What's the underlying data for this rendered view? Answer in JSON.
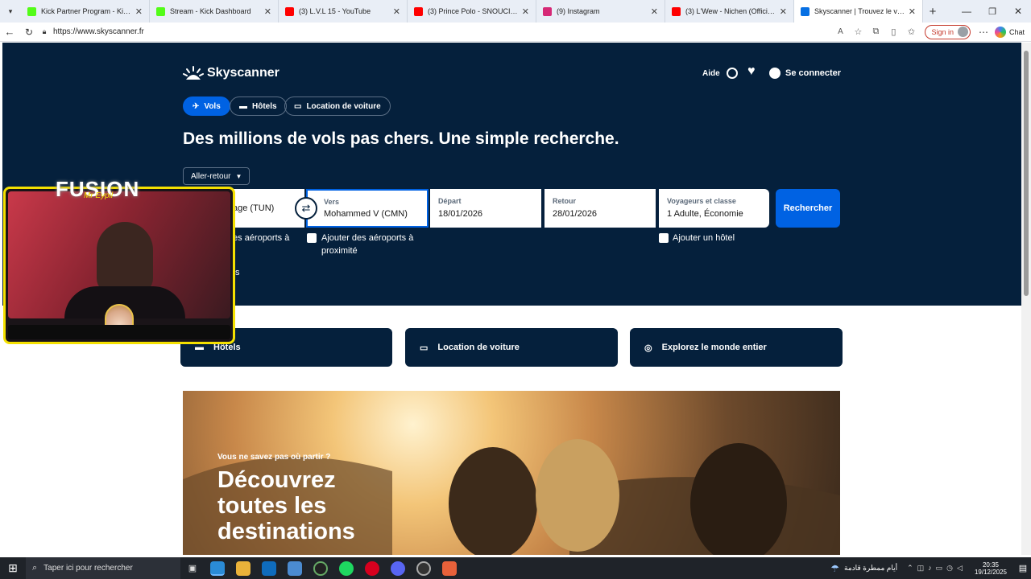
{
  "browser": {
    "tabs": [
      {
        "title": "Kick Partner Program - Kick Dashb",
        "favicon_color": "#53fc18"
      },
      {
        "title": "Stream - Kick Dashboard",
        "favicon_color": "#53fc18"
      },
      {
        "title": "(3) L.V.L 15 - YouTube",
        "favicon_color": "#ff0000"
      },
      {
        "title": "(3) Prince Polo - SNOUCI (Official",
        "favicon_color": "#ff0000"
      },
      {
        "title": "(9) Instagram",
        "favicon_color": "#d62976"
      },
      {
        "title": "(3) L'Wew - Nichen (Official Lyric V",
        "favicon_color": "#ff0000"
      },
      {
        "title": "Skyscanner | Trouvez le vol pas ch",
        "favicon_color": "#0770e3"
      }
    ],
    "new_tab": "+",
    "url": "https://www.skyscanner.fr",
    "sign_in": "Sign in",
    "chat": "Chat"
  },
  "site": {
    "logo": "Skyscanner",
    "header": {
      "help": "Aide",
      "login": "Se connecter"
    },
    "nav_pills": [
      {
        "label": "Vols",
        "active": true
      },
      {
        "label": "Hôtels",
        "active": false
      },
      {
        "label": "Location de voiture",
        "active": false
      }
    ],
    "headline": "Des millions de vols pas chers. Une simple recherche.",
    "trip_type": "Aller-retour",
    "search": {
      "from_partial": "age (TUN)",
      "to": {
        "label": "Vers",
        "value": "Mohammed V (CMN)"
      },
      "depart": {
        "label": "Départ",
        "value": "18/01/2026"
      },
      "return": {
        "label": "Retour",
        "value": "28/01/2026"
      },
      "travelers": {
        "label": "Voyageurs et classe",
        "value": "1 Adulte, Économie"
      },
      "button": "Rechercher"
    },
    "options": {
      "nearby_from_partial": "es aéroports à",
      "nearby_to": "Ajouter des aéroports à proximité",
      "hotel": "Ajouter un hôtel",
      "direct_partial": "ts"
    },
    "cards": [
      {
        "label": "Hôtels"
      },
      {
        "label": "Location de voiture"
      },
      {
        "label": "Explorez le monde entier"
      }
    ],
    "promo": {
      "kicker": "Vous ne savez pas où partir ?",
      "title_lines": [
        "Découvrez",
        "toutes les",
        "destinations"
      ]
    }
  },
  "overlay": {
    "brand": "FUSION",
    "script": "Mr Eypil"
  },
  "taskbar": {
    "search_placeholder": "Taper ici pour rechercher",
    "weather": "أيام ممطرة قادمة",
    "time": "20:35",
    "date": "19/12/2025"
  }
}
